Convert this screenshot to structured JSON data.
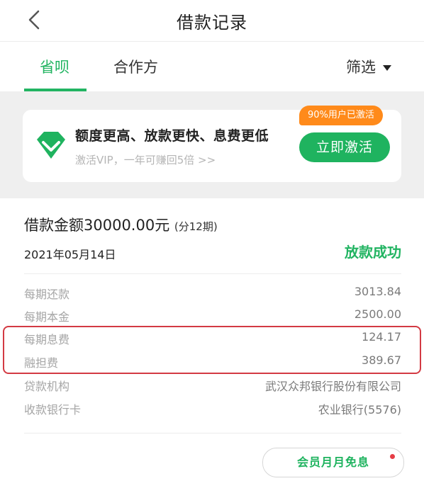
{
  "header": {
    "title": "借款记录"
  },
  "tabs": {
    "active": "省呗",
    "partner": "合作方",
    "filter": "筛选"
  },
  "vip": {
    "headline": "额度更高、放款更快、息费更低",
    "sub": "激活VIP，一年可赚回5倍 >>",
    "badge": "90%用户已激活",
    "button": "立即激活",
    "accent_color": "#1fb35f",
    "badge_color": "#ff8a1a"
  },
  "record": {
    "amount": "借款金额30000.00元",
    "periods": "(分12期)",
    "date": "2021年05月14日",
    "status": "放款成功",
    "rows": [
      {
        "label": "每期还款",
        "value": "3013.84"
      },
      {
        "label": "每期本金",
        "value": "2500.00"
      },
      {
        "label": "每期息费",
        "value": "124.17"
      },
      {
        "label": "融担费",
        "value": "389.67"
      },
      {
        "label": "贷款机构",
        "value": "武汉众邦银行股份有限公司"
      },
      {
        "label": "收款银行卡",
        "value": "农业银行(5576)"
      }
    ],
    "highlight_color": "#d33a43"
  },
  "promo": {
    "label": "会员月月免息"
  }
}
